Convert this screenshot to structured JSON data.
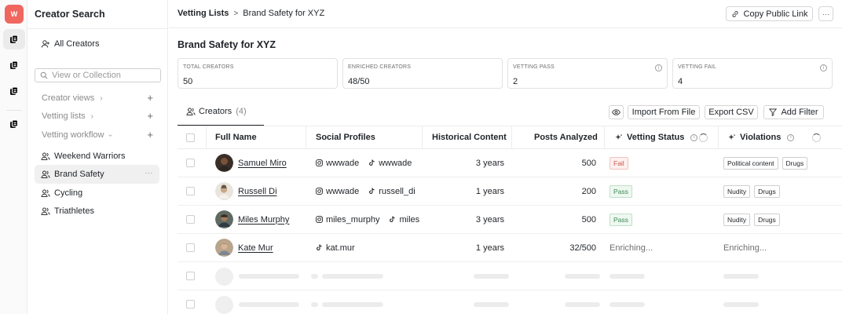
{
  "workspace": {
    "badge": "W"
  },
  "sidebar": {
    "title": "Creator Search",
    "all_creators": "All Creators",
    "search_placeholder": "View or Collection",
    "sections": [
      {
        "label": "Creator views"
      },
      {
        "label": "Vetting lists"
      },
      {
        "label": "Vetting workflow"
      }
    ],
    "lists": [
      {
        "label": "Weekend Warriors",
        "active": false
      },
      {
        "label": "Brand Safety",
        "active": true
      },
      {
        "label": "Cycling",
        "active": false
      },
      {
        "label": "Triathletes",
        "active": false
      }
    ],
    "more_label": "···"
  },
  "header": {
    "breadcrumb_root": "Vetting Lists",
    "breadcrumb_current": "Brand Safety for XYZ",
    "copy_link_label": "Copy Public Link",
    "more_label": "···"
  },
  "page": {
    "title": "Brand Safety for XYZ"
  },
  "stats": [
    {
      "label": "TOTAL CREATORS",
      "value": "50"
    },
    {
      "label": "ENRICHED CREATORS",
      "value": "48/50"
    },
    {
      "label": "VETTING PASS",
      "value": "2"
    },
    {
      "label": "VETTING FAIL",
      "value": "4"
    }
  ],
  "toolbar": {
    "tab_label": "Creators",
    "tab_count": "(4)",
    "import_label": "Import From File",
    "export_label": "Export CSV",
    "filter_label": "Add Filter"
  },
  "table": {
    "columns": {
      "name": "Full Name",
      "social": "Social Profiles",
      "historical": "Historical Content",
      "posts": "Posts Analyzed",
      "vetting": "Vetting Status",
      "violations": "Violations"
    },
    "rows": [
      {
        "name": "Samuel Miro",
        "instagram": "wwwade",
        "tiktok": "wwwade",
        "historical": "3 years",
        "posts": "500",
        "status": "Fail",
        "violations": [
          "Political content",
          "Drugs"
        ]
      },
      {
        "name": "Russell Di",
        "instagram": "wwwade",
        "tiktok": "russell_di",
        "historical": "1 years",
        "posts": "200",
        "status": "Pass",
        "violations": [
          "Nudity",
          "Drugs"
        ]
      },
      {
        "name": "Miles Murphy",
        "instagram": "miles_murphy",
        "tiktok": "miles",
        "historical": "3 years",
        "posts": "500",
        "status": "Pass",
        "violations": [
          "Nudity",
          "Drugs"
        ]
      },
      {
        "name": "Kate Mur",
        "instagram": "",
        "tiktok": "kat.mur",
        "historical": "1 years",
        "posts": "32/500",
        "status_text": "Enriching...",
        "violations_text": "Enriching..."
      }
    ]
  },
  "colors": {
    "brand": "#f0675f",
    "pass": "#3c8a55",
    "fail": "#d0544a"
  },
  "icons": {
    "rail": [
      "workspace-icon",
      "list-icon",
      "list-icon",
      "list-icon"
    ],
    "instagram": "instagram-icon",
    "tiktok": "tiktok-icon"
  }
}
